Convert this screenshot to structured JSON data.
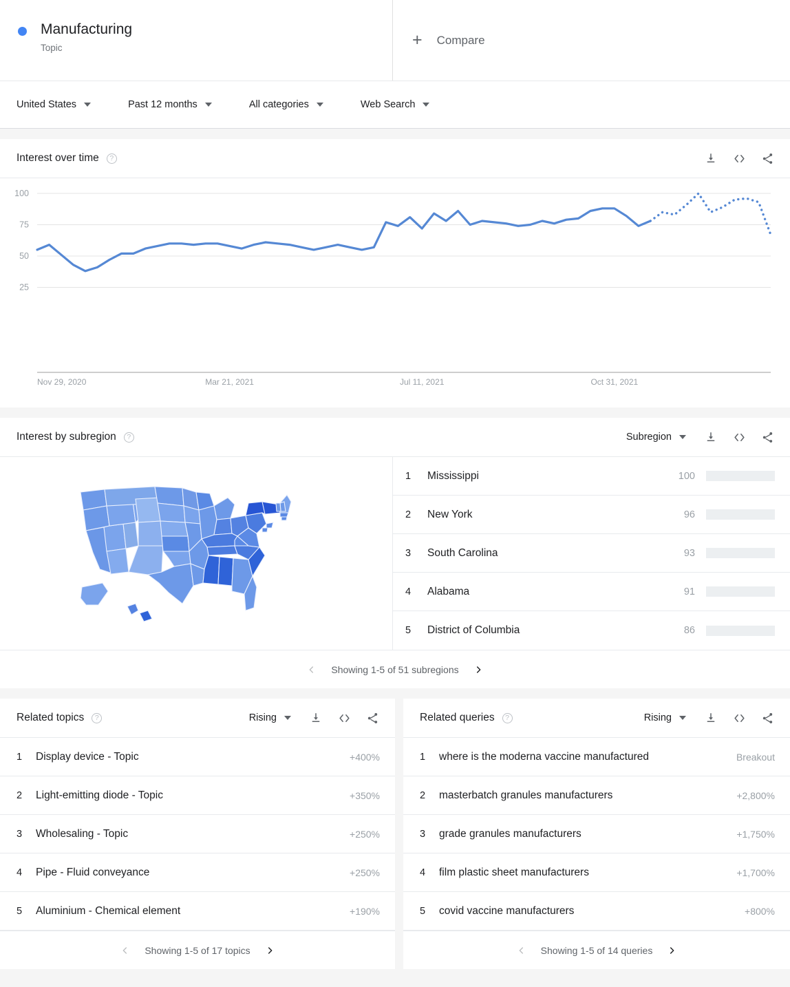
{
  "header": {
    "term": "Manufacturing",
    "term_type": "Topic",
    "compare_label": "Compare",
    "compare_plus": "+"
  },
  "filters": [
    {
      "label": "United States",
      "name": "location"
    },
    {
      "label": "Past 12 months",
      "name": "time-range"
    },
    {
      "label": "All categories",
      "name": "category"
    },
    {
      "label": "Web Search",
      "name": "search-type"
    }
  ],
  "interest_over_time": {
    "title": "Interest over time",
    "help": "?",
    "actions": [
      "download-icon",
      "embed-icon",
      "share-icon"
    ]
  },
  "interest_by_subregion": {
    "title": "Interest by subregion",
    "help": "?",
    "dropdown": "Subregion",
    "rows": [
      {
        "rank": "1",
        "name": "Mississippi",
        "value": 100,
        "value_label": "100"
      },
      {
        "rank": "2",
        "name": "New York",
        "value": 96,
        "value_label": "96"
      },
      {
        "rank": "3",
        "name": "South Carolina",
        "value": 93,
        "value_label": "93"
      },
      {
        "rank": "4",
        "name": "Alabama",
        "value": 91,
        "value_label": "91"
      },
      {
        "rank": "5",
        "name": "District of Columbia",
        "value": 86,
        "value_label": "86"
      }
    ],
    "pager": "Showing 1-5 of 51 subregions"
  },
  "related_topics": {
    "title": "Related topics",
    "help": "?",
    "dropdown": "Rising",
    "rows": [
      {
        "rank": "1",
        "label": "Display device - Topic",
        "growth": "+400%"
      },
      {
        "rank": "2",
        "label": "Light-emitting diode - Topic",
        "growth": "+350%"
      },
      {
        "rank": "3",
        "label": "Wholesaling - Topic",
        "growth": "+250%"
      },
      {
        "rank": "4",
        "label": "Pipe - Fluid conveyance",
        "growth": "+250%"
      },
      {
        "rank": "5",
        "label": "Aluminium - Chemical element",
        "growth": "+190%"
      }
    ],
    "pager": "Showing 1-5 of 17 topics"
  },
  "related_queries": {
    "title": "Related queries",
    "help": "?",
    "dropdown": "Rising",
    "rows": [
      {
        "rank": "1",
        "label": "where is the moderna vaccine manufactured",
        "growth": "Breakout"
      },
      {
        "rank": "2",
        "label": "masterbatch granules manufacturers",
        "growth": "+2,800%"
      },
      {
        "rank": "3",
        "label": "grade granules manufacturers",
        "growth": "+1,750%"
      },
      {
        "rank": "4",
        "label": "film plastic sheet manufacturers",
        "growth": "+1,700%"
      },
      {
        "rank": "5",
        "label": "covid vaccine manufacturers",
        "growth": "+800%"
      }
    ],
    "pager": "Showing 1-5 of 14 queries"
  },
  "colors": {
    "accent": "#4285f4",
    "line": "#5588d4",
    "grid": "#e0e0e0",
    "muted": "#9aa0a6"
  },
  "chart_data": {
    "type": "line",
    "title": "Interest over time",
    "xlabel": "",
    "ylabel": "",
    "ylim": [
      0,
      100
    ],
    "yticks": [
      25,
      50,
      75,
      100
    ],
    "ytick_labels": [
      "25",
      "50",
      "75",
      "100"
    ],
    "xtick_labels": [
      "Nov 29, 2020",
      "Mar 21, 2021",
      "Jul 11, 2021",
      "Oct 31, 2021"
    ],
    "xtick_positions": [
      0,
      16,
      32,
      48
    ],
    "grid": true,
    "legend": false,
    "partial_data_from_index": 51,
    "series": [
      {
        "name": "Manufacturing",
        "color": "#5588d4",
        "values": [
          55,
          59,
          51,
          43,
          38,
          41,
          47,
          52,
          52,
          56,
          58,
          60,
          60,
          59,
          60,
          60,
          58,
          56,
          59,
          61,
          60,
          59,
          57,
          55,
          57,
          59,
          57,
          55,
          57,
          77,
          74,
          81,
          72,
          84,
          78,
          86,
          75,
          78,
          77,
          76,
          74,
          75,
          78,
          76,
          79,
          80,
          86,
          88,
          88,
          82,
          74,
          78,
          85,
          83,
          91,
          100,
          85,
          89,
          95,
          96,
          93,
          67
        ]
      }
    ]
  }
}
